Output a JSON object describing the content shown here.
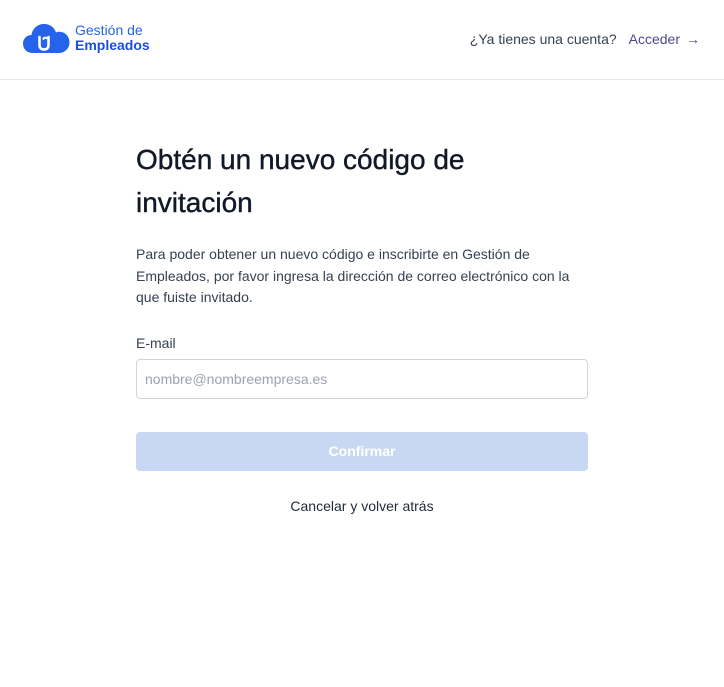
{
  "header": {
    "logo": {
      "line1": "Gestión de",
      "line2": "Empleados"
    },
    "account_question": "¿Ya tienes una cuenta?",
    "login_label": "Acceder",
    "login_arrow": "→"
  },
  "main": {
    "title": "Obtén un nuevo código de invitación",
    "description": "Para poder obtener un nuevo código e inscribirte en Gestión de Empleados, por favor ingresa la dirección de correo electrónico con la que fuiste invitado.",
    "email": {
      "label": "E-mail",
      "placeholder": "nombre@nombreempresa.es",
      "value": ""
    },
    "confirm_label": "Confirmar",
    "cancel_label": "Cancelar y volver atrás"
  },
  "colors": {
    "brand": "#2563eb",
    "brand_dark": "#1d4ed8",
    "button_disabled": "#c9d8f2",
    "link": "#4b4a8a"
  }
}
